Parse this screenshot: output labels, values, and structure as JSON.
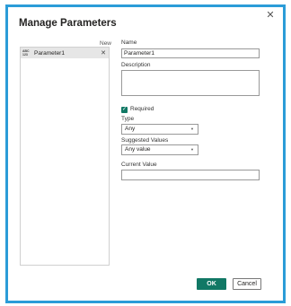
{
  "dialog": {
    "title": "Manage Parameters",
    "close_icon": "close-icon"
  },
  "list": {
    "new_label": "New",
    "items": [
      {
        "icon": "abc-123-type-icon",
        "icon_text_top": "ABC",
        "icon_text_bottom": "123",
        "label": "Parameter1",
        "remove_icon": "close-icon"
      }
    ]
  },
  "form": {
    "name_label": "Name",
    "name_value": "Parameter1",
    "description_label": "Description",
    "description_value": "",
    "required_label": "Required",
    "required_checked": true,
    "type_label": "Type",
    "type_value": "Any",
    "suggested_values_label": "Suggested Values",
    "suggested_values_value": "Any value",
    "current_value_label": "Current Value",
    "current_value_value": ""
  },
  "buttons": {
    "ok_label": "OK",
    "cancel_label": "Cancel"
  },
  "colors": {
    "frame_border": "#2b9cd8",
    "accent": "#117865",
    "selected_item_bg": "#e6e6e6"
  }
}
